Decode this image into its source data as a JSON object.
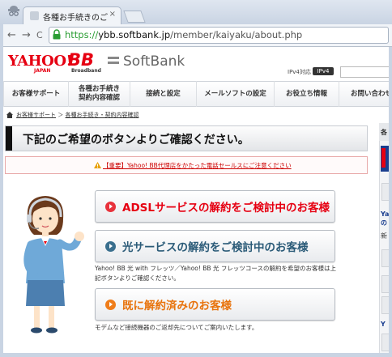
{
  "browser": {
    "tab_title": "各種お手続きのご案内 |",
    "tab_close": "×",
    "back_glyph": "←",
    "forward_glyph": "→",
    "reload_glyph": "C",
    "url_scheme": "https://",
    "url_host": "ybb.softbank.jp",
    "url_path": "/member/kaiyaku/about.php"
  },
  "header": {
    "logo_yahoo": "YAHOO!",
    "logo_japan": "JAPAN",
    "logo_bb": "BB",
    "logo_broadband": "Broadband",
    "logo_softbank": "SoftBank",
    "ipv4_label": "IPv4対応",
    "ipv4_badge": "IPv4"
  },
  "global_nav": [
    {
      "label": "お客様サポート"
    },
    {
      "label": "各種お手続き\n契約内容確認"
    },
    {
      "label": "接続と設定"
    },
    {
      "label": "メールソフトの設定"
    },
    {
      "label": "お役立ち情報"
    },
    {
      "label": "お問い合わせ"
    }
  ],
  "breadcrumb": {
    "item1": "お客様サポート",
    "sep": "＞",
    "item2": "各種お手続き・契約内容確認"
  },
  "main": {
    "heading": "下記のご希望のボタンよりご確認ください。",
    "notice": "【重要】Yahoo! BB代理店をかたった電話セールスにご注意ください",
    "buttons": [
      {
        "label": "ADSLサービスの解約をご検討中のお客様"
      },
      {
        "label": "光サービスの解約をご検討中のお客様"
      },
      {
        "label": "既に解約済みのお客様"
      }
    ],
    "desc2": "Yahoo! BB 光 with フレッツ／Yahoo! BB 光 フレッツコースの解約を希望のお客様は上記ボタンよりご確認ください。",
    "desc3": "モデムなど接続機器のご返却先についてご案内いたします。"
  },
  "sidebar": {
    "t1": "各",
    "t2": "Ya",
    "t3": "の",
    "t4": "新",
    "t5": "Y"
  },
  "colors": {
    "brand_red": "#e60012",
    "light_blue": "#2b5b78",
    "orange": "#e8730c"
  }
}
